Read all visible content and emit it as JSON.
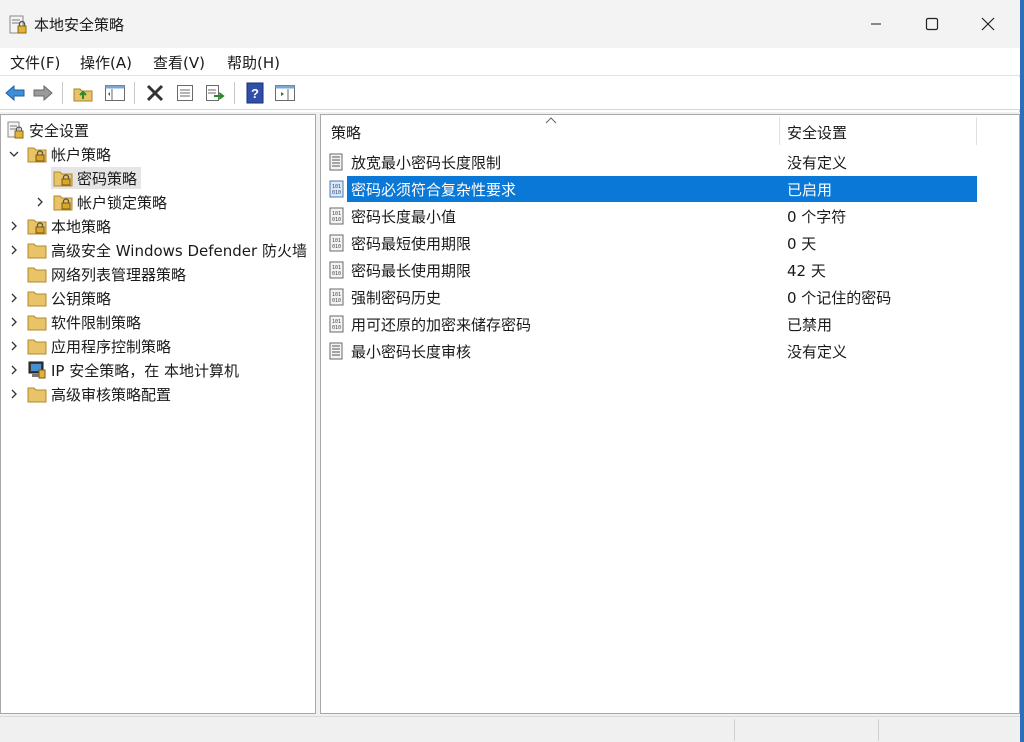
{
  "window": {
    "title": "本地安全策略"
  },
  "menu": [
    {
      "label": "文件(F)"
    },
    {
      "label": "操作(A)"
    },
    {
      "label": "查看(V)"
    },
    {
      "label": "帮助(H)"
    }
  ],
  "toolbar": [
    {
      "icon": "back-arrow-icon"
    },
    {
      "icon": "forward-arrow-icon"
    },
    {
      "icon": "up-folder-icon"
    },
    {
      "icon": "show-hide-tree-icon"
    },
    {
      "icon": "delete-icon"
    },
    {
      "icon": "properties-icon"
    },
    {
      "icon": "export-list-icon"
    },
    {
      "icon": "help-icon"
    },
    {
      "icon": "show-action-pane-icon"
    }
  ],
  "tree": [
    {
      "label": "安全设置",
      "level": 0,
      "chevron": "none",
      "icon": "security-root-icon"
    },
    {
      "label": "帐户策略",
      "level": 1,
      "chevron": "expanded",
      "icon": "lock-folder-icon"
    },
    {
      "label": "密码策略",
      "level": 2,
      "chevron": "none",
      "icon": "lock-folder-icon",
      "selected": true
    },
    {
      "label": "帐户锁定策略",
      "level": 2,
      "chevron": "collapsed",
      "icon": "lock-folder-icon"
    },
    {
      "label": "本地策略",
      "level": 1,
      "chevron": "collapsed",
      "icon": "lock-folder-icon"
    },
    {
      "label": "高级安全 Windows Defender 防火墙",
      "level": 1,
      "chevron": "collapsed",
      "icon": "folder-icon"
    },
    {
      "label": "网络列表管理器策略",
      "level": 1,
      "chevron": "none",
      "icon": "folder-icon"
    },
    {
      "label": "公钥策略",
      "level": 1,
      "chevron": "collapsed",
      "icon": "folder-icon"
    },
    {
      "label": "软件限制策略",
      "level": 1,
      "chevron": "collapsed",
      "icon": "folder-icon"
    },
    {
      "label": "应用程序控制策略",
      "level": 1,
      "chevron": "collapsed",
      "icon": "folder-icon"
    },
    {
      "label": "IP 安全策略，在 本地计算机",
      "level": 1,
      "chevron": "collapsed",
      "icon": "ip-security-icon"
    },
    {
      "label": "高级审核策略配置",
      "level": 1,
      "chevron": "collapsed",
      "icon": "folder-icon"
    }
  ],
  "list": {
    "columns": [
      {
        "label": "策略"
      },
      {
        "label": "安全设置"
      }
    ],
    "rows": [
      {
        "name": "放宽最小密码长度限制",
        "value": "没有定义",
        "icon": "policy-text-icon"
      },
      {
        "name": "密码必须符合复杂性要求",
        "value": "已启用",
        "icon": "policy-binary-icon",
        "selected": true
      },
      {
        "name": "密码长度最小值",
        "value": "0 个字符",
        "icon": "policy-binary-icon"
      },
      {
        "name": "密码最短使用期限",
        "value": "0 天",
        "icon": "policy-binary-icon"
      },
      {
        "name": "密码最长使用期限",
        "value": "42 天",
        "icon": "policy-binary-icon"
      },
      {
        "name": "强制密码历史",
        "value": "0 个记住的密码",
        "icon": "policy-binary-icon"
      },
      {
        "name": "用可还原的加密来储存密码",
        "value": "已禁用",
        "icon": "policy-binary-icon"
      },
      {
        "name": "最小密码长度审核",
        "value": "没有定义",
        "icon": "policy-text-icon"
      }
    ]
  },
  "colors": {
    "selection": "#0a78d7",
    "folder": "#e8c368",
    "desktop": "#2b6fb8"
  }
}
